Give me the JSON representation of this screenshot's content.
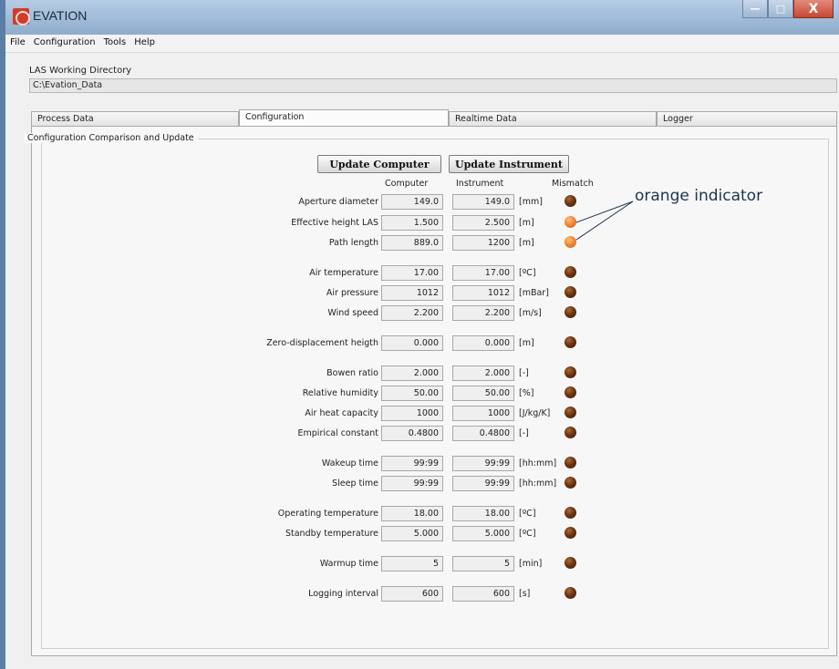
{
  "window": {
    "title": "EVATION",
    "minimize": "—",
    "maximize": "□",
    "close": "X"
  },
  "menu": [
    "File",
    "Configuration",
    "Tools",
    "Help"
  ],
  "working_dir": {
    "label": "LAS Working Directory",
    "value": "C:\\Evation_Data"
  },
  "tabs": [
    "Process Data",
    "Configuration",
    "Realtime Data",
    "Logger"
  ],
  "active_tab": "Configuration",
  "group_title": "Configuration Comparison and Update",
  "buttons": {
    "update_computer": "Update Computer",
    "update_instrument": "Update Instrument"
  },
  "columns": {
    "computer": "Computer",
    "instrument": "Instrument",
    "mismatch": "Mismatch"
  },
  "rows": [
    {
      "label": "Aperture diameter",
      "computer": "149.0",
      "instrument": "149.0",
      "unit": "[mm]",
      "mismatch": "brown"
    },
    {
      "label": "Effective height LAS",
      "computer": "1.500",
      "instrument": "2.500",
      "unit": "[m]",
      "mismatch": "orange"
    },
    {
      "label": "Path length",
      "computer": "889.0",
      "instrument": "1200",
      "unit": "[m]",
      "mismatch": "orange"
    },
    {
      "label": "Air temperature",
      "computer": "17.00",
      "instrument": "17.00",
      "unit": "[ºC]",
      "mismatch": "brown"
    },
    {
      "label": "Air pressure",
      "computer": "1012",
      "instrument": "1012",
      "unit": "[mBar]",
      "mismatch": "brown"
    },
    {
      "label": "Wind speed",
      "computer": "2.200",
      "instrument": "2.200",
      "unit": "[m/s]",
      "mismatch": "brown"
    },
    {
      "label": "Zero-displacement heigth",
      "computer": "0.000",
      "instrument": "0.000",
      "unit": "[m]",
      "mismatch": "brown"
    },
    {
      "label": "Bowen ratio",
      "computer": "2.000",
      "instrument": "2.000",
      "unit": "[-]",
      "mismatch": "brown"
    },
    {
      "label": "Relative humidity",
      "computer": "50.00",
      "instrument": "50.00",
      "unit": "[%]",
      "mismatch": "brown"
    },
    {
      "label": "Air heat capacity",
      "computer": "1000",
      "instrument": "1000",
      "unit": "[J/kg/K]",
      "mismatch": "brown"
    },
    {
      "label": "Empirical constant",
      "computer": "0.4800",
      "instrument": "0.4800",
      "unit": "[-]",
      "mismatch": "brown"
    },
    {
      "label": "Wakeup time",
      "computer": "99:99",
      "instrument": "99:99",
      "unit": "[hh:mm]",
      "mismatch": "brown"
    },
    {
      "label": "Sleep time",
      "computer": "99:99",
      "instrument": "99:99",
      "unit": "[hh:mm]",
      "mismatch": "brown"
    },
    {
      "label": "Operating temperature",
      "computer": "18.00",
      "instrument": "18.00",
      "unit": "[ºC]",
      "mismatch": "brown"
    },
    {
      "label": "Standby temperature",
      "computer": "5.000",
      "instrument": "5.000",
      "unit": "[ºC]",
      "mismatch": "brown"
    },
    {
      "label": "Warmup time",
      "computer": "5",
      "instrument": "5",
      "unit": "[min]",
      "mismatch": "brown"
    },
    {
      "label": "Logging interval",
      "computer": "600",
      "instrument": "600",
      "unit": "[s]",
      "mismatch": "brown"
    }
  ],
  "annotation": "orange indicator",
  "colors": {
    "led_brown": "#6e3510",
    "led_orange": "#f08a36",
    "titlebar": "#a4bedb"
  }
}
